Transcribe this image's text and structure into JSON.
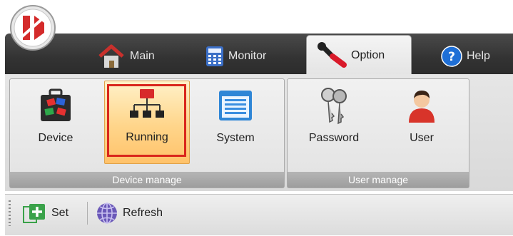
{
  "app": {
    "logo_icon": "app-logo-icon"
  },
  "tabs": [
    {
      "label": "Main",
      "icon": "house-icon",
      "active": false
    },
    {
      "label": "Monitor",
      "icon": "calculator-icon",
      "active": false
    },
    {
      "label": "Option",
      "icon": "wrench-icon",
      "active": true
    },
    {
      "label": "Help",
      "icon": "help-icon",
      "active": false
    }
  ],
  "groups": {
    "device_manage": {
      "label": "Device manage",
      "buttons": [
        {
          "label": "Device",
          "icon": "device-case-icon"
        },
        {
          "label": "Running",
          "icon": "network-tree-icon",
          "highlighted": true
        },
        {
          "label": "System",
          "icon": "window-list-icon"
        }
      ]
    },
    "user_manage": {
      "label": "User manage",
      "buttons": [
        {
          "label": "Password",
          "icon": "keys-icon"
        },
        {
          "label": "User",
          "icon": "user-icon"
        }
      ]
    }
  },
  "toolbar": {
    "set_label": "Set",
    "set_icon": "add-icon",
    "refresh_label": "Refresh",
    "refresh_icon": "globe-icon"
  },
  "colors": {
    "highlight_border": "#d9261c",
    "active_button": "#ffd58a",
    "tabbar": "#3a3a3a"
  }
}
